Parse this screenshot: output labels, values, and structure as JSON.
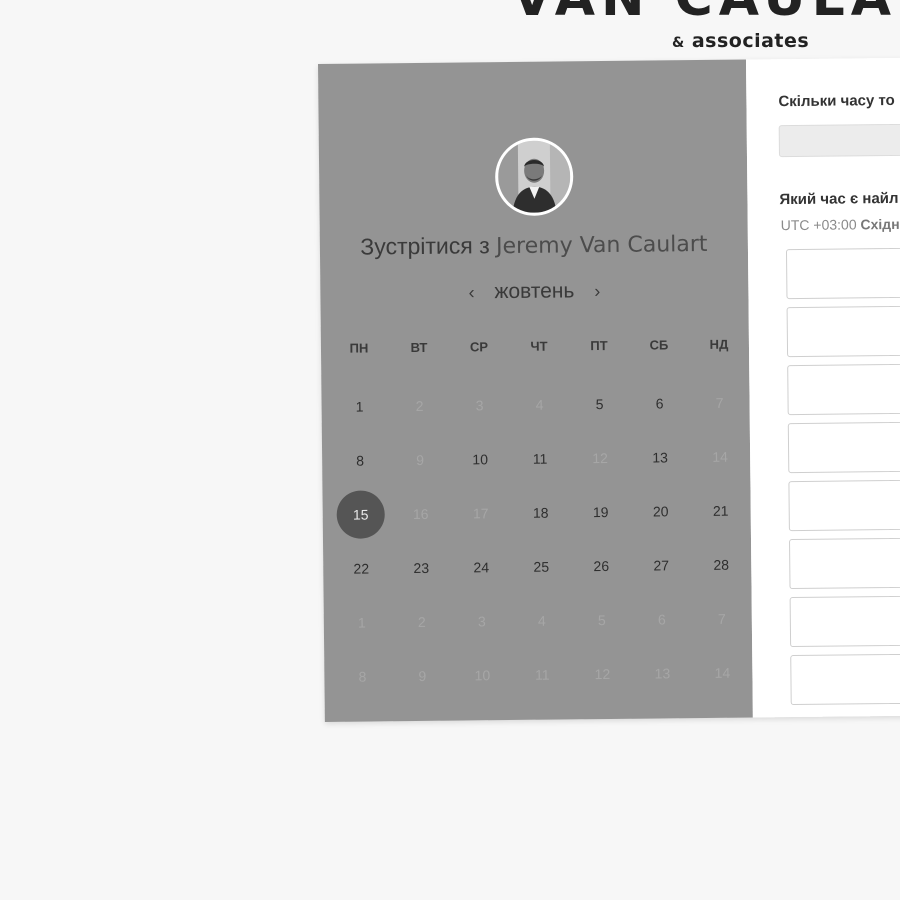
{
  "brand": {
    "title": "VAN CAULART",
    "subtitle_amp": "&",
    "subtitle_text": "associates"
  },
  "host": {
    "meet_prefix": "Зустрітися з",
    "name": "Jeremy Van Caulart"
  },
  "calendar": {
    "month": "жовтень",
    "prev": "‹",
    "next": "›",
    "weekdays": [
      "ПН",
      "ВТ",
      "СР",
      "ЧТ",
      "ПТ",
      "СБ",
      "НД"
    ],
    "weeks": [
      [
        {
          "d": "1",
          "s": "on"
        },
        {
          "d": "2",
          "s": "off"
        },
        {
          "d": "3",
          "s": "off"
        },
        {
          "d": "4",
          "s": "off"
        },
        {
          "d": "5",
          "s": "on"
        },
        {
          "d": "6",
          "s": "on"
        },
        {
          "d": "7",
          "s": "off"
        }
      ],
      [
        {
          "d": "8",
          "s": "on"
        },
        {
          "d": "9",
          "s": "off"
        },
        {
          "d": "10",
          "s": "on"
        },
        {
          "d": "11",
          "s": "on"
        },
        {
          "d": "12",
          "s": "off"
        },
        {
          "d": "13",
          "s": "on"
        },
        {
          "d": "14",
          "s": "off"
        }
      ],
      [
        {
          "d": "15",
          "s": "selected"
        },
        {
          "d": "16",
          "s": "off"
        },
        {
          "d": "17",
          "s": "off"
        },
        {
          "d": "18",
          "s": "on"
        },
        {
          "d": "19",
          "s": "on"
        },
        {
          "d": "20",
          "s": "on"
        },
        {
          "d": "21",
          "s": "on"
        }
      ],
      [
        {
          "d": "22",
          "s": "on"
        },
        {
          "d": "23",
          "s": "on"
        },
        {
          "d": "24",
          "s": "on"
        },
        {
          "d": "25",
          "s": "on"
        },
        {
          "d": "26",
          "s": "on"
        },
        {
          "d": "27",
          "s": "on"
        },
        {
          "d": "28",
          "s": "on"
        }
      ],
      [
        {
          "d": "1",
          "s": "off"
        },
        {
          "d": "2",
          "s": "off"
        },
        {
          "d": "3",
          "s": "off"
        },
        {
          "d": "4",
          "s": "off"
        },
        {
          "d": "5",
          "s": "off"
        },
        {
          "d": "6",
          "s": "off"
        },
        {
          "d": "7",
          "s": "off"
        }
      ],
      [
        {
          "d": "8",
          "s": "off"
        },
        {
          "d": "9",
          "s": "off"
        },
        {
          "d": "10",
          "s": "off"
        },
        {
          "d": "11",
          "s": "off"
        },
        {
          "d": "12",
          "s": "off"
        },
        {
          "d": "13",
          "s": "off"
        },
        {
          "d": "14",
          "s": "off"
        }
      ]
    ]
  },
  "booking": {
    "duration_question": "Скільки часу то",
    "time_question": "Який час є найл",
    "tz_offset": "UTC +03:00",
    "tz_name": "Східн",
    "slot_count": 8
  },
  "colors": {
    "panel_gray": "#949494",
    "selected_day": "#555555",
    "page_bg": "#f7f7f7"
  }
}
